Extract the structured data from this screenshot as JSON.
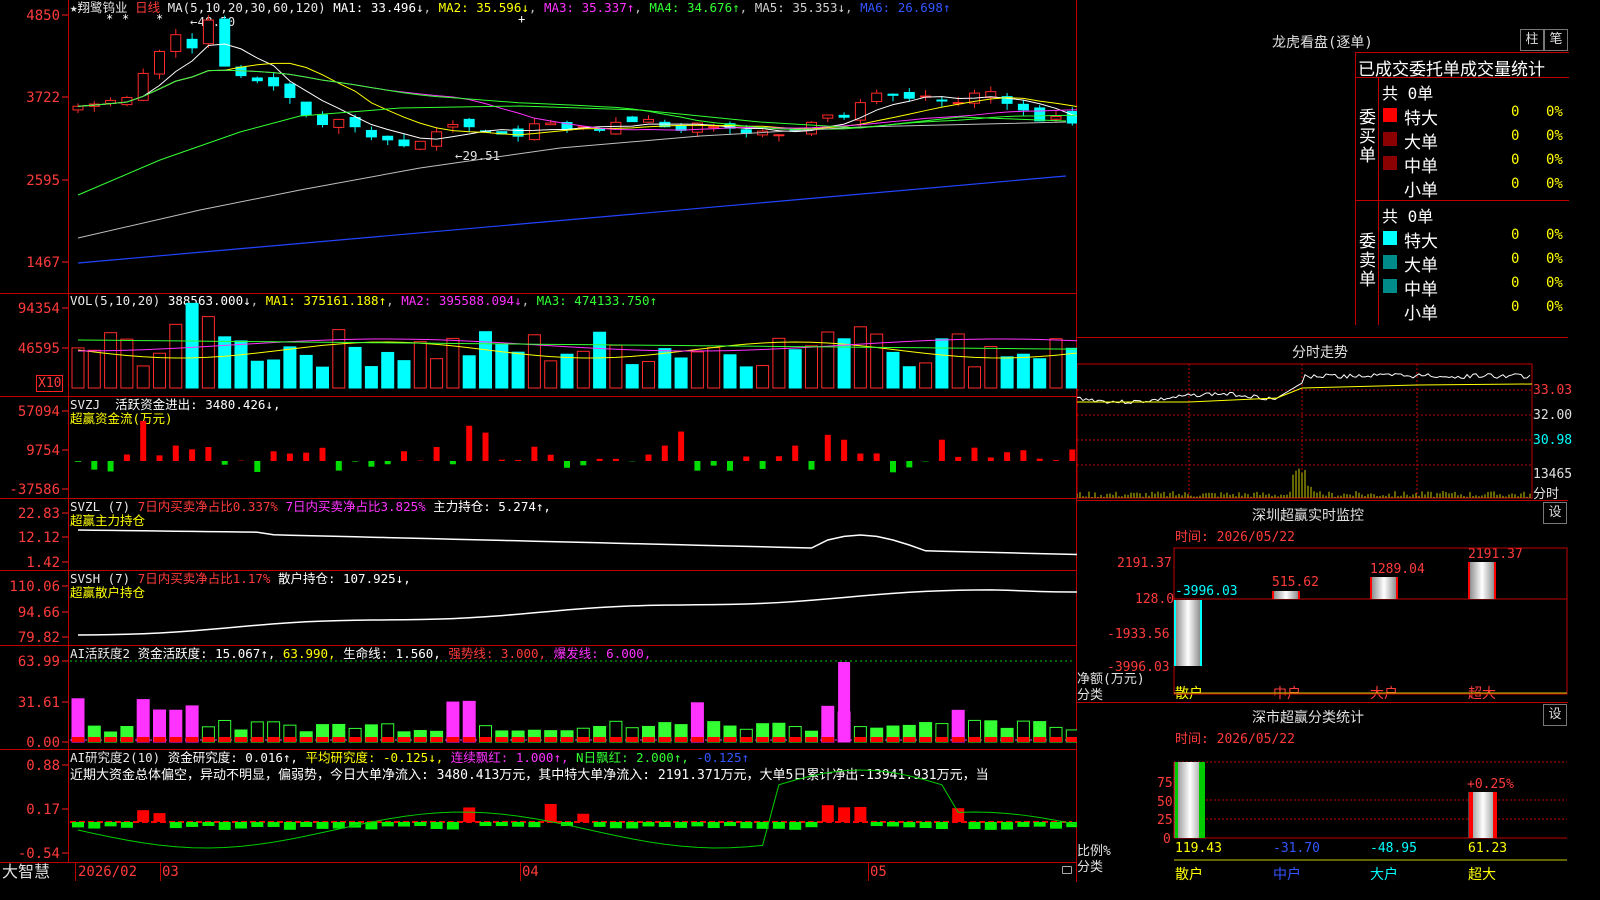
{
  "stock": {
    "name": "★翔鹭钨业",
    "period": "日线"
  },
  "colors": {
    "up": "#ff2a2a",
    "down": "#00ffff",
    "bull": "#00ff00",
    "grid": "#c00000",
    "text_red": "#ff3b3b"
  },
  "main": {
    "ma_params": "MA(5,10,20,30,60,120)",
    "ma1": "MA1: 33.496↓",
    "ma2": "MA2: 35.596↓",
    "ma3": "MA3: 35.337↑",
    "ma4": "MA4: 34.676↑",
    "ma5": "MA5: 35.353↓",
    "ma6": "MA6: 26.698↑",
    "high_mark": "←48.50",
    "low_mark": "←29.51",
    "yticks": [
      "4850",
      "3722",
      "2595",
      "1467"
    ]
  },
  "vol": {
    "label": "VOL(5,10,20)",
    "val": "388563.000↓",
    "ma1": "MA1: 375161.188↑",
    "ma2": "MA2: 395588.094↓",
    "ma3": "MA3: 474133.750↑",
    "yticks": [
      "94354",
      "46595"
    ],
    "unit": "X10"
  },
  "svzj": {
    "label": "SVZJ",
    "name": "活跃资金进出: 3480.426↓,",
    "sub": "超赢资金流(万元)",
    "yticks": [
      "57094",
      "9754",
      "-37586"
    ]
  },
  "svzl": {
    "label": "SVZL (7)",
    "a": "7日内买卖净占比0.337%",
    "b": "7日内买卖净占比3.825%",
    "c": "主力持仓: 5.274↑,",
    "sub": "超赢主力持仓",
    "yticks": [
      "22.83",
      "12.12",
      "1.42"
    ]
  },
  "svsh": {
    "label": "SVSH (7)",
    "a": "7日内买卖净占比1.17%",
    "c": "散户持仓: 107.925↓,",
    "sub": "超赢散户持仓",
    "yticks": [
      "110.06",
      "94.66",
      "79.82"
    ]
  },
  "ai1": {
    "label": "AI活跃度2",
    "a": "资金活跃度: 15.067↑,",
    "b": "63.990,",
    "c": "生命线: 1.560,",
    "d": "强势线: 3.000,",
    "e": "爆发线: 6.000,",
    "yticks": [
      "63.99",
      "31.61",
      "0.00"
    ]
  },
  "ai2": {
    "label": "AI研究度2(10)",
    "a": "资金研究度: 0.016↑,",
    "b": "平均研究度: -0.125↓,",
    "c": "连续飘红: 1.000↑,",
    "d": "N日飘红: 2.000↑,",
    "e": "-0.125↑",
    "comment": "近期大资金总体偏空，异动不明显，偏弱势，今日大单净流入: 3480.413万元，其中特大单净流入: 2191.371万元，大单5日累计净出-13941.931万元，当",
    "yticks": [
      "0.88",
      "0.17",
      "-0.54"
    ]
  },
  "xaxis": {
    "brand": "大智慧",
    "labels": [
      "2026/02",
      "03",
      "04",
      "05"
    ]
  },
  "right": {
    "title": "龙虎看盘(逐单)",
    "btn1": "柱",
    "btn2": "笔",
    "tabs": "已成交委托单成交量统计",
    "buy_label": "委买单",
    "sell_label": "委卖单",
    "buy_total": "共 0单",
    "sell_total": "共 0单",
    "rows": [
      {
        "name": "特大",
        "n": "0",
        "p": "0%"
      },
      {
        "name": "大单",
        "n": "0",
        "p": "0%"
      },
      {
        "name": "中单",
        "n": "0",
        "p": "0%"
      },
      {
        "name": "小单",
        "n": "0",
        "p": "0%"
      }
    ],
    "minute_title": "分时走势",
    "minute_yticks": [
      "33.03",
      "32.00",
      "30.98",
      "13465",
      "分时"
    ],
    "monitor_title": "深圳超赢实时监控",
    "monitor_btn": "设",
    "monitor_time": "时间: 2026/05/22",
    "monitor_yticks": [
      "2191.37",
      "128.0",
      "-1933.56",
      "-3996.03"
    ],
    "monitor_vals": {
      "sanhu": "-3996.03",
      "zhonghu": "515.62",
      "dahu": "1289.04",
      "chaoda": "2191.37"
    },
    "monitor_ylabel": "净额(万元)",
    "monitor_xlabel": "分类",
    "cats": [
      "散户",
      "中户",
      "大户",
      "超大"
    ],
    "stats_title": "深市超赢分类统计",
    "stats_btn": "设",
    "stats_time": "时间: 2026/05/22",
    "stats_yticks": [
      "75",
      "50",
      "25",
      "0"
    ],
    "stats_ylabel": "比例%",
    "stats_xlabel": "分类",
    "stats_vals": [
      "119.43",
      "-31.70",
      "-48.95",
      "61.23"
    ],
    "stats_mark": "+0.25%"
  }
}
